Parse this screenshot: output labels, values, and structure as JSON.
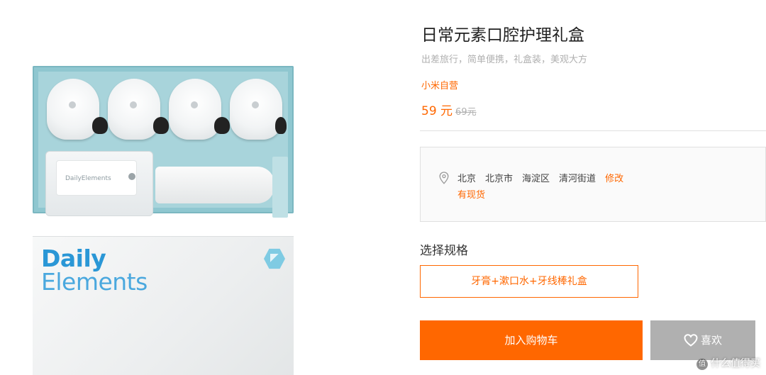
{
  "product": {
    "title": "日常元素口腔护理礼盒",
    "subtitle": "出差旅行，简单便携，礼盒装，美观大方",
    "seller": "小米自营",
    "price": "59 元",
    "original_price": "69元"
  },
  "gallery": {
    "floss_label": "DailyElements",
    "brand_line1": "Daily",
    "brand_line2": "Elements"
  },
  "address": {
    "icon": "location-pin-icon",
    "province": "北京",
    "city": "北京市",
    "district": "海淀区",
    "street": "清河街道",
    "edit_label": "修改",
    "stock_status": "有现货"
  },
  "spec": {
    "label": "选择规格",
    "options": [
      "牙膏+漱口水+牙线棒礼盒"
    ]
  },
  "actions": {
    "add_to_cart": "加入购物车",
    "like": "喜欢",
    "like_icon": "heart-icon"
  },
  "watermark": {
    "badge": "值",
    "text": "什么值得买"
  },
  "colors": {
    "accent": "#ff6700",
    "like_button": "#b0b0b0",
    "brand_blue": "#2a97d6"
  }
}
